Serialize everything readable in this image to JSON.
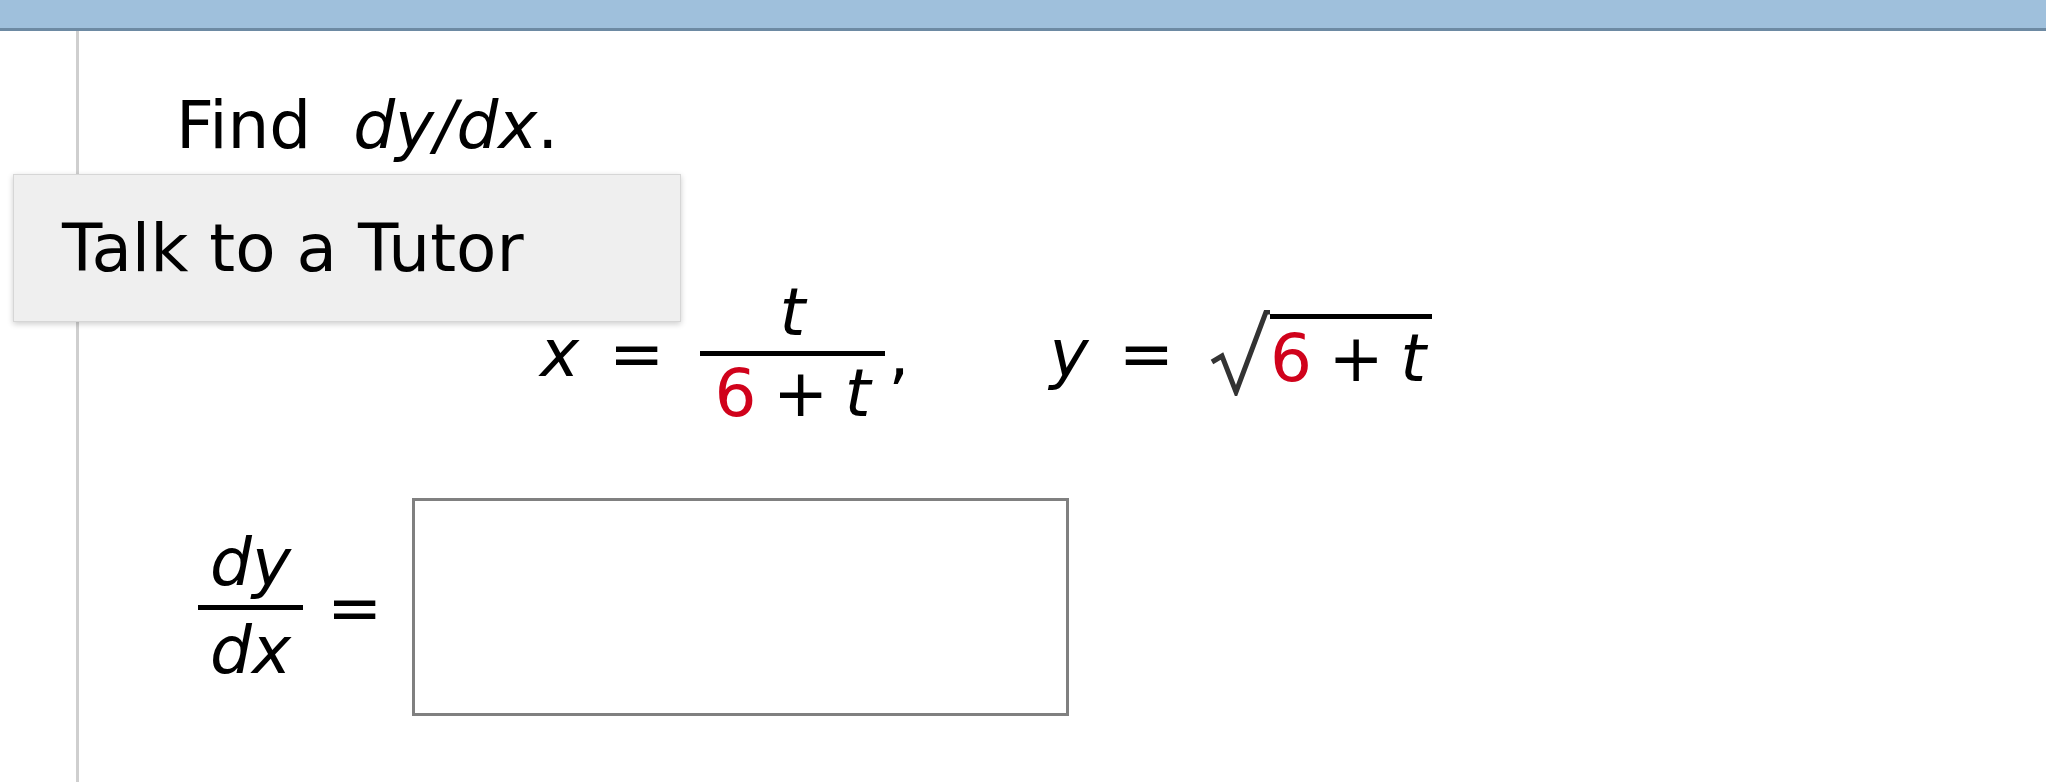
{
  "prompt": {
    "text": "Find  *dy/dx*."
  },
  "tooltip": {
    "text": "Talk to a Tutor"
  },
  "equations": [
    {
      "kind": "fraction",
      "variable": "x",
      "equals": "=",
      "numerator": [
        {
          "kind": "variable",
          "text": "t"
        }
      ],
      "denominator": [
        {
          "kind": "number",
          "text": "6",
          "color": "#d0021b"
        },
        {
          "kind": "operator",
          "text": "+"
        },
        {
          "kind": "variable",
          "text": "t"
        }
      ],
      "separator": ","
    },
    {
      "kind": "root",
      "variable": "y",
      "equals": "=",
      "radicand": [
        {
          "kind": "number",
          "text": "6",
          "color": "#d0021b"
        },
        {
          "kind": "operator",
          "text": "+"
        },
        {
          "kind": "variable",
          "text": "t"
        }
      ]
    }
  ],
  "answer": {
    "numerator": "dy",
    "denominator": "dx",
    "equals": "="
  }
}
